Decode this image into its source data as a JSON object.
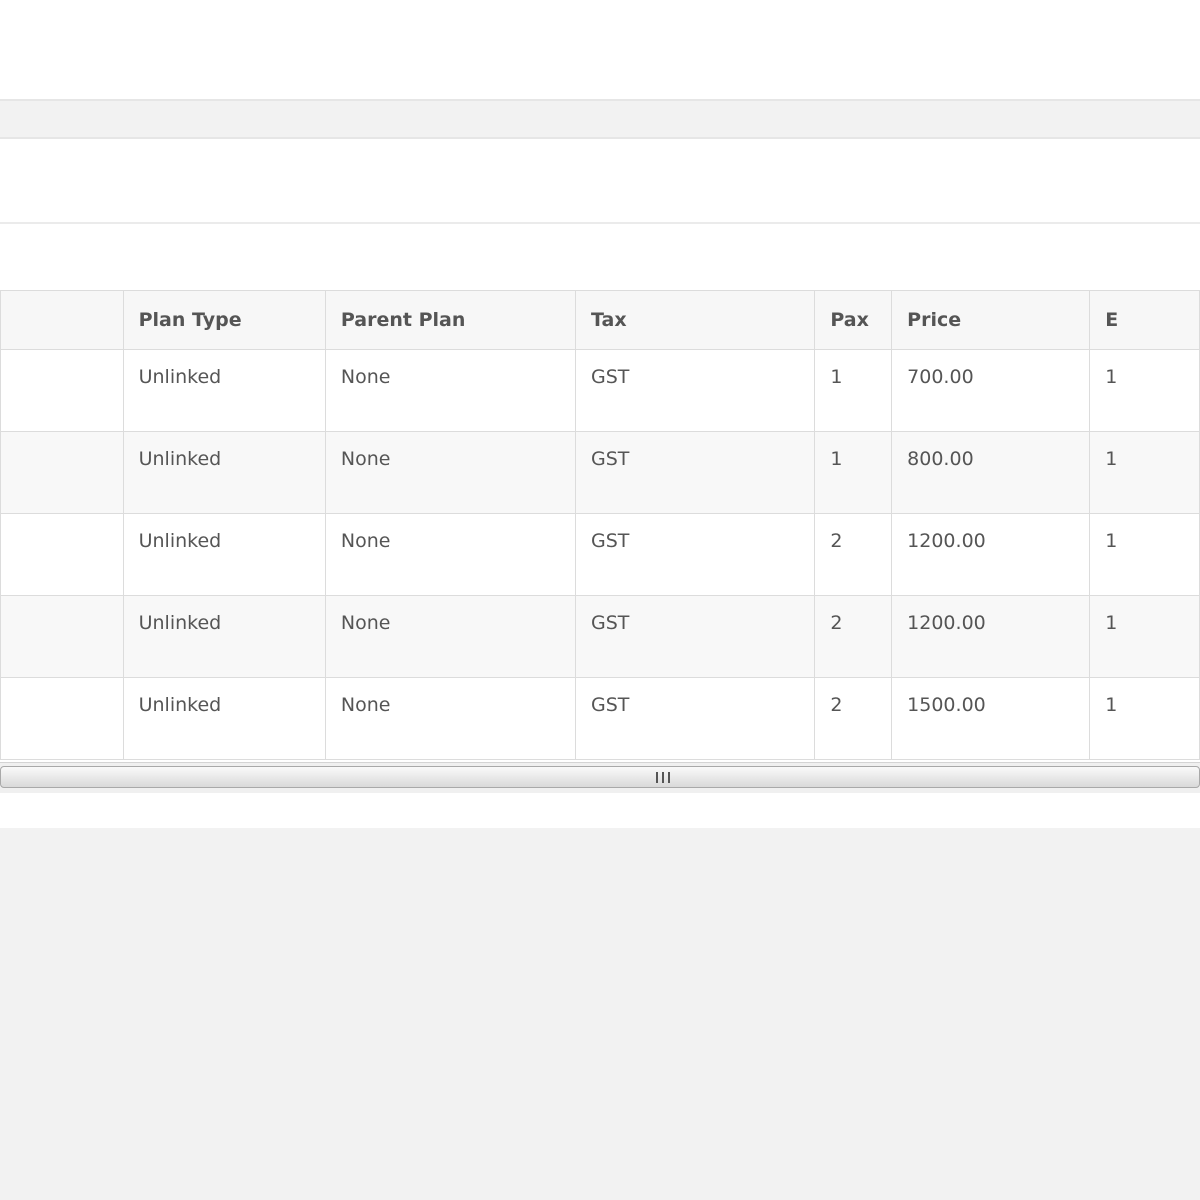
{
  "table": {
    "columns": [
      "",
      "Plan Type",
      "Parent Plan",
      "Tax",
      "Pax",
      "Price",
      "E"
    ],
    "rows": [
      {
        "first": "",
        "plan_type": "Unlinked",
        "parent_plan": "None",
        "tax": "GST",
        "pax": "1",
        "price": "700.00",
        "extra": "1"
      },
      {
        "first": "",
        "plan_type": "Unlinked",
        "parent_plan": "None",
        "tax": "GST",
        "pax": "1",
        "price": "800.00",
        "extra": "1"
      },
      {
        "first": "",
        "plan_type": "Unlinked",
        "parent_plan": "None",
        "tax": "GST",
        "pax": "2",
        "price": "1200.00",
        "extra": "1"
      },
      {
        "first": "",
        "plan_type": "Unlinked",
        "parent_plan": "None",
        "tax": "GST",
        "pax": "2",
        "price": "1200.00",
        "extra": "1"
      },
      {
        "first": "",
        "plan_type": "Unlinked",
        "parent_plan": "None",
        "tax": "GST",
        "pax": "2",
        "price": "1500.00",
        "extra": "1"
      }
    ]
  },
  "scrollbar": {
    "grip_icon": "grip-lines-icon"
  }
}
